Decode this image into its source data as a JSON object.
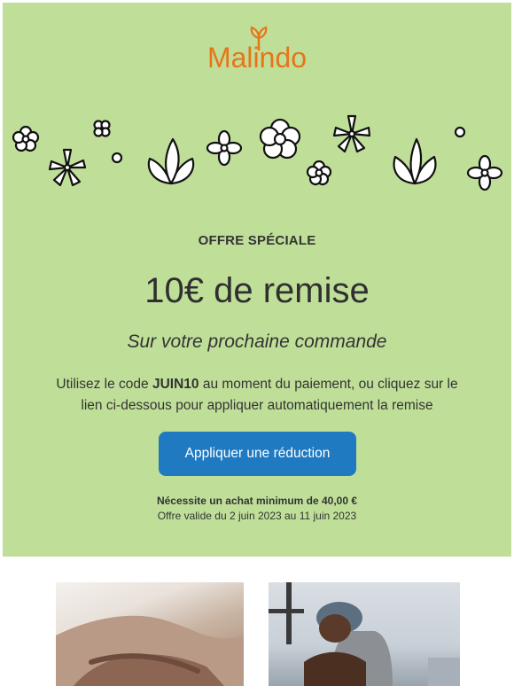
{
  "brand": {
    "name": "Malindo",
    "color": "#e8741a"
  },
  "promo": {
    "background": "#bfdf99",
    "kicker": "OFFRE SPÉCIALE",
    "headline": "10€ de remise",
    "subhead": "Sur votre prochaine commande",
    "body_before": "Utilisez le code ",
    "code": "JUIN10",
    "body_after": " au moment du paiement, ou cliquez sur le lien ci-dessous pour appliquer automatiquement la remise",
    "cta_label": "Appliquer une réduction",
    "cta_color": "#1f7ac2",
    "min_purchase": "Nécessite un achat minimum de 40,00 €",
    "validity": "Offre valide du 2 juin 2023 au 11 juin 2023"
  },
  "decoration": {
    "icons": [
      "flower-icon",
      "tulip-icon",
      "dot-icon"
    ]
  },
  "photos": [
    {
      "name": "photo-person-holding-stomach"
    },
    {
      "name": "photo-man-with-cap-exercising"
    }
  ]
}
